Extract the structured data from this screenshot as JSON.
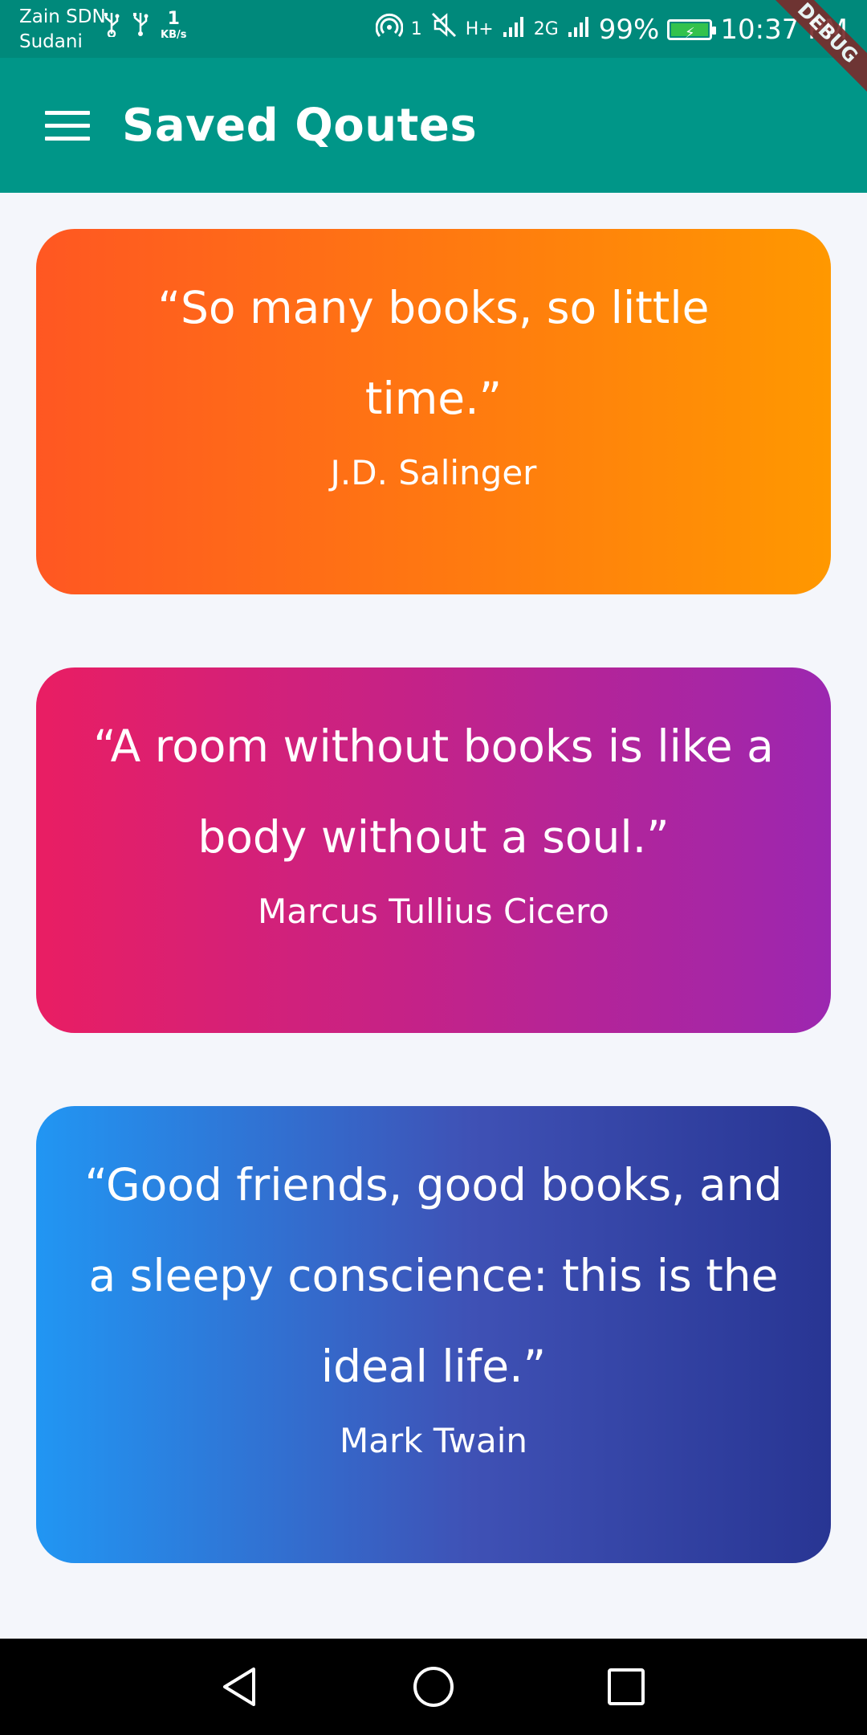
{
  "status_bar": {
    "carrier_line1": "Zain SDN",
    "carrier_line2": "Sudani",
    "speed_value": "1",
    "speed_unit": "KB/s",
    "hotspot_count": "1",
    "net1": "H+",
    "net2": "2G",
    "battery_percent": "99%",
    "time": "10:37 PM",
    "battery_color": "#33c24d"
  },
  "debug_banner": "DEBUG",
  "app_bar": {
    "title": "Saved Qoutes",
    "color": "#009688"
  },
  "quotes": [
    {
      "text": "“So many books, so little time.”",
      "author": "J.D. Salinger",
      "gradient": [
        "#ff5722",
        "#ff9800"
      ]
    },
    {
      "text": "“A room without books is like a body without a soul.”",
      "author": "Marcus Tullius Cicero",
      "gradient": [
        "#e91e63",
        "#9c27b0"
      ]
    },
    {
      "text": "“Good friends, good books, and a sleepy conscience: this is the ideal life.”",
      "author": "Mark Twain",
      "gradient": [
        "#2196f3",
        "#283593"
      ]
    }
  ],
  "nav_bar": {
    "back_icon": "triangle-back-icon",
    "home_icon": "circle-home-icon",
    "recent_icon": "square-recents-icon"
  }
}
